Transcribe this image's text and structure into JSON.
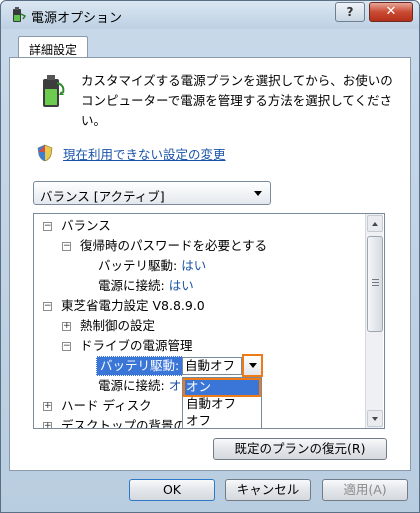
{
  "window": {
    "title": "電源オプション",
    "help_label": "?",
    "close_label": "✕"
  },
  "tabs": [
    {
      "label": "詳細設定"
    }
  ],
  "description": "カスタマイズする電源プランを選択してから、お使いのコンピューターで電源を管理する方法を選択してください。",
  "link": {
    "label": "現在利用できない設定の変更"
  },
  "plan_select": {
    "value": "バランス [アクティブ]"
  },
  "tree": {
    "balance": "バランス",
    "password": "復帰時のパスワードを必要とする",
    "battery_label": "バッテリ駆動:",
    "battery_value": "はい",
    "ac_label": "電源に接続:",
    "ac_value": "はい",
    "toshiba": "東芝省電力設定 V8.8.9.0",
    "heat": "熱制御の設定",
    "drive": "ドライブの電源管理",
    "drive_battery_label": "バッテリ駆動:",
    "drive_ac_label": "電源に接続:",
    "drive_ac_value": "オ",
    "harddisk": "ハード ディスク",
    "desktop": "デスクトップの背景の"
  },
  "dropdown": {
    "current": "自動オフ",
    "options": [
      "オン",
      "自動オフ",
      "オフ"
    ]
  },
  "buttons": {
    "restore": "既定のプランの復元(R)",
    "ok": "OK",
    "cancel": "キャンセル",
    "apply": "適用(A)"
  },
  "colors": {
    "selection": "#3a75d8",
    "highlight_outline": "#ef7b17",
    "link": "#1a53a8"
  }
}
